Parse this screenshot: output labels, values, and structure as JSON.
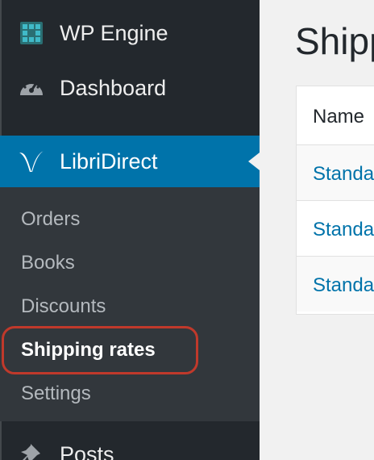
{
  "sidebar": {
    "items": [
      {
        "label": "WP Engine",
        "icon": "wpengine-grid-icon"
      },
      {
        "label": "Dashboard",
        "icon": "dashboard-gauge-icon"
      },
      {
        "label": "LibriDirect",
        "icon": "libridirect-v-logo-icon"
      },
      {
        "label": "Posts",
        "icon": "pushpin-icon"
      }
    ],
    "submenu": {
      "items": [
        "Orders",
        "Books",
        "Discounts",
        "Shipping rates",
        "Settings"
      ],
      "active": "Shipping rates"
    },
    "colors": {
      "background": "#23282d",
      "active": "#0073aa",
      "submenu": "#32373c"
    }
  },
  "main": {
    "title": "Shipp",
    "table": {
      "header": "Name",
      "rows": [
        "Standa",
        "Standa",
        "Standa"
      ]
    },
    "link_color": "#0073aa",
    "highlight_color": "#c0392b"
  }
}
